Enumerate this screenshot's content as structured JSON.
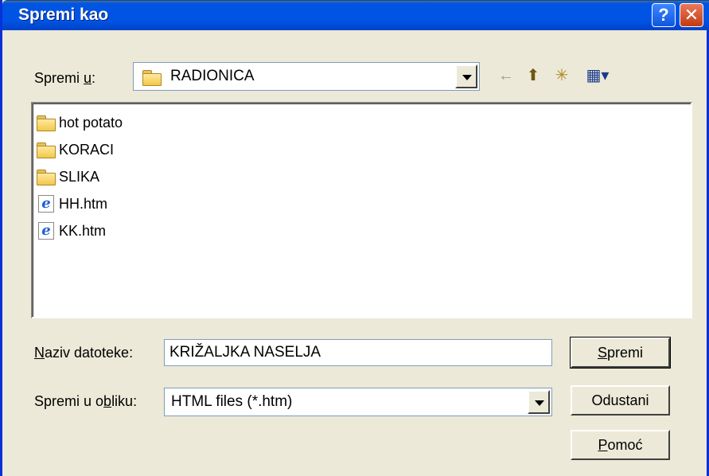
{
  "window": {
    "title": "Spremi kao",
    "help_label": "?",
    "close_label": "✕"
  },
  "location": {
    "label_prefix": "Spremi ",
    "label_hotkey": "u",
    "label_suffix": ":",
    "value": "RADIONICA"
  },
  "toolbar": {
    "back_icon": "←",
    "up_icon": "⬆",
    "new_folder_icon": "✳",
    "view_icon": "▦▾"
  },
  "files": [
    {
      "name": "hot potato",
      "type": "folder"
    },
    {
      "name": "KORACI",
      "type": "folder"
    },
    {
      "name": "SLIKA",
      "type": "folder"
    },
    {
      "name": "HH.htm",
      "type": "html"
    },
    {
      "name": "KK.htm",
      "type": "html"
    }
  ],
  "filename": {
    "label_hotkey": "N",
    "label_rest": "aziv datoteke:",
    "value": "KRIŽALJKA NASELJA"
  },
  "filetype": {
    "label_prefix": "Spremi u o",
    "label_hotkey": "b",
    "label_suffix": "liku:",
    "value": "HTML files (*.htm)"
  },
  "buttons": {
    "save_hotkey": "S",
    "save_rest": "premi",
    "cancel": "Odustani",
    "help_hotkey": "P",
    "help_rest": "omoć"
  },
  "colors": {
    "titlebar": "#0054e3",
    "face": "#ece9d8",
    "close": "#c23a12"
  }
}
